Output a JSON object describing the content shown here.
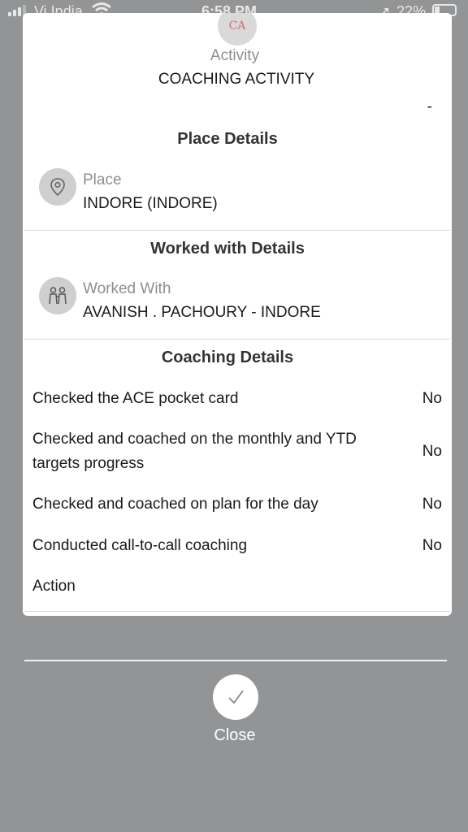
{
  "status_bar": {
    "carrier": "Vi India",
    "time": "6:58 PM",
    "battery": "22%"
  },
  "header": {
    "avatar_initials": "CA",
    "activity_label": "Activity",
    "activity_value": "COACHING ACTIVITY",
    "dash": "-"
  },
  "place_section": {
    "title": "Place Details",
    "icon": "location-pin-icon",
    "label": "Place",
    "value": "INDORE (INDORE)"
  },
  "worked_section": {
    "title": "Worked with Details",
    "icon": "people-icon",
    "label": "Worked With",
    "value": "AVANISH . PACHOURY - INDORE"
  },
  "coaching_section": {
    "title": "Coaching Details",
    "rows": [
      {
        "question": "Checked the ACE pocket card",
        "answer": "No"
      },
      {
        "question": "Checked and coached on the monthly and YTD targets progress",
        "answer": "No"
      },
      {
        "question": "Checked and coached on plan for the day",
        "answer": "No"
      },
      {
        "question": "Conducted call-to-call coaching",
        "answer": "No"
      }
    ],
    "action_label": "Action"
  },
  "footer": {
    "close_label": "Close",
    "close_icon": "checkmark-icon"
  },
  "colors": {
    "overlay": "#939496",
    "card": "#ffffff",
    "icon_circle": "#cfcfcf",
    "muted_text": "#8e8e8e",
    "avatar_text": "#d56c6c"
  }
}
